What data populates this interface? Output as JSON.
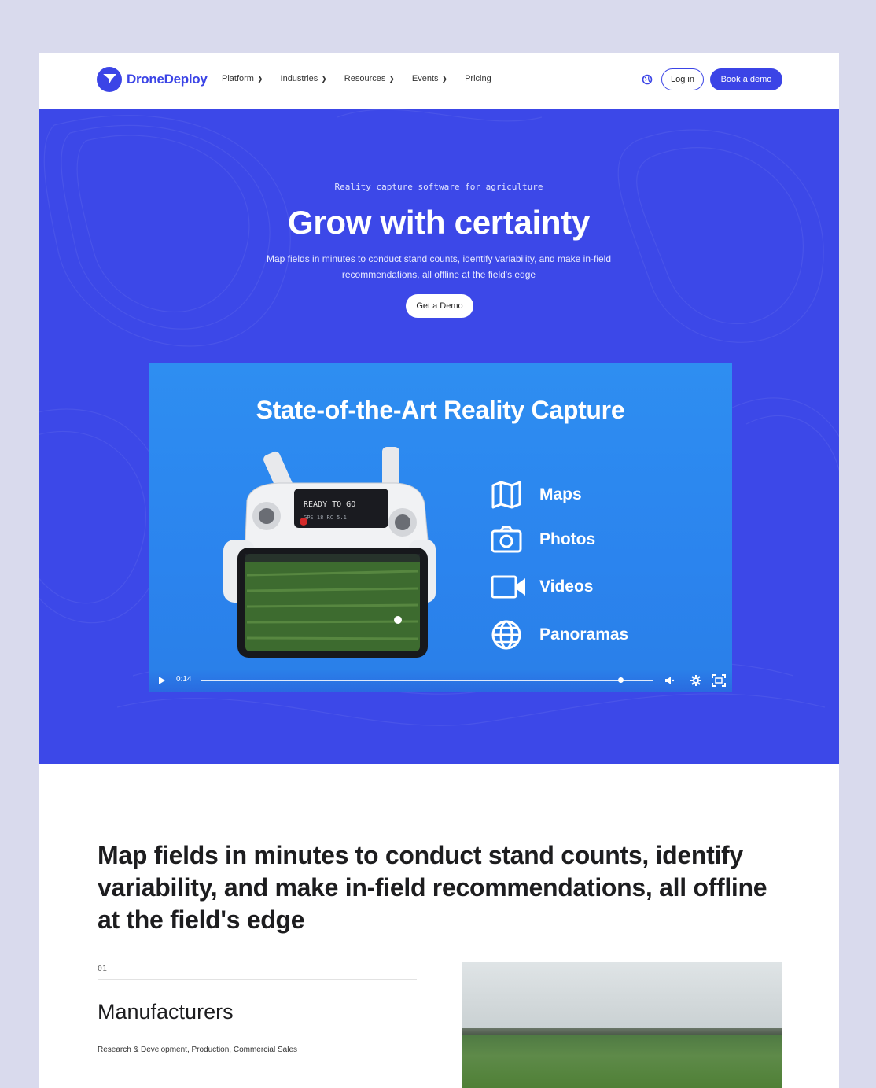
{
  "nav": {
    "logo_text": "DroneDeploy",
    "menu": [
      {
        "label": "Platform",
        "has_dropdown": true
      },
      {
        "label": "Industries",
        "has_dropdown": true
      },
      {
        "label": "Resources",
        "has_dropdown": true
      },
      {
        "label": "Events",
        "has_dropdown": true
      },
      {
        "label": "Pricing",
        "has_dropdown": false
      }
    ],
    "globe_icon": "globe-icon",
    "login_label": "Log in",
    "book_demo_label": "Book a demo"
  },
  "hero": {
    "eyebrow": "Reality capture software for agriculture",
    "title": "Grow with certainty",
    "subtitle": "Map fields in minutes to conduct stand counts, identify variability, and make in-field recommendations, all offline at the field's edge",
    "cta_label": "Get a Demo"
  },
  "video": {
    "title": "State-of-the-Art Reality Capture",
    "features": [
      {
        "icon": "map-icon",
        "label": "Maps"
      },
      {
        "icon": "camera-icon",
        "label": "Photos"
      },
      {
        "icon": "video-icon",
        "label": "Videos"
      },
      {
        "icon": "globe-icon",
        "label": "Panoramas"
      }
    ],
    "time": "0:14",
    "progress": 0.93
  },
  "content": {
    "headline": "Map fields in minutes to conduct stand counts, identify variability, and make in-field recommendations, all offline at the field's edge",
    "item_number": "01",
    "item_title": "Manufacturers",
    "item_subtitle": "Research & Development, Production, Commercial Sales"
  },
  "colors": {
    "brand": "#3b44e6",
    "hero_bg": "#3c48e8",
    "video_bg": "#2e8ef1",
    "page_bg": "#d9daed"
  }
}
